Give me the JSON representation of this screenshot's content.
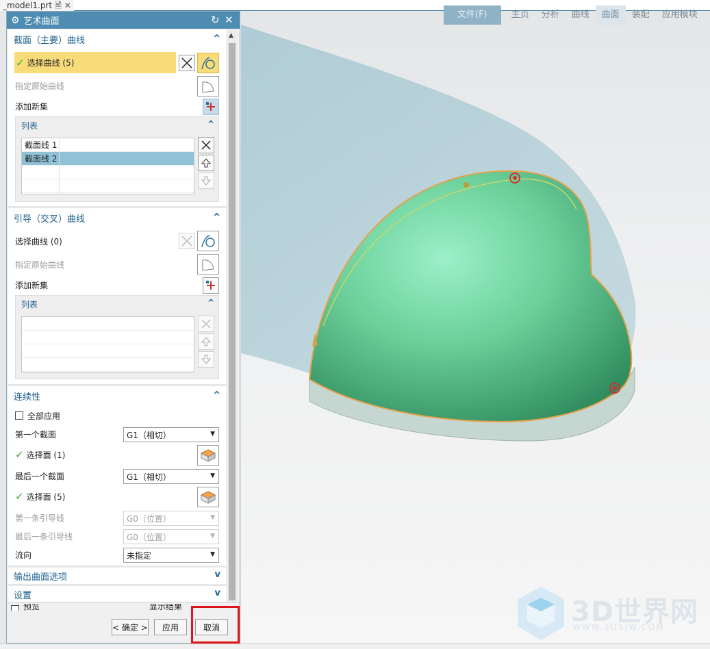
{
  "file_tab": {
    "name": "_model1.prt",
    "close_glyph": "✕",
    "doc_icon": "document-icon"
  },
  "ribbon": {
    "tabs": [
      {
        "label": "文件(F)",
        "state": "file"
      },
      {
        "label": "主页",
        "state": "normal"
      },
      {
        "label": "分析",
        "state": "normal"
      },
      {
        "label": "曲线",
        "state": "normal"
      },
      {
        "label": "曲面",
        "state": "active"
      },
      {
        "label": "装配",
        "state": "normal"
      },
      {
        "label": "应用模块",
        "state": "normal"
      }
    ]
  },
  "dialog": {
    "title": "艺术曲面",
    "section_primary": {
      "title": "截面（主要）曲线",
      "select_curve": "选择曲线 (5)",
      "specify_origin": "指定原始曲线",
      "add_new_set": "添加新集",
      "list_title": "列表",
      "list_items": [
        "截面线 1",
        "截面线 2",
        "",
        ""
      ],
      "selected_index": 1
    },
    "section_guide": {
      "title": "引导（交叉）曲线",
      "select_curve": "选择曲线 (0)",
      "specify_origin": "指定原始曲线",
      "add_new_set": "添加新集",
      "list_title": "列表"
    },
    "continuity": {
      "title": "连续性",
      "apply_all": "全部应用",
      "first_section": "第一个截面",
      "first_section_value": "G1（相切）",
      "select_face_1": "选择面 (1)",
      "last_section": "最后一个截面",
      "last_section_value": "G1（相切）",
      "select_face_2": "选择面 (5)",
      "first_guide": "第一条引导线",
      "first_guide_value": "G0（位置）",
      "last_guide": "最后一条引导线",
      "last_guide_value": "G0（位置）",
      "flow_direction": "流向",
      "flow_direction_value": "未指定"
    },
    "output_options": "输出曲面选项",
    "settings": "设置",
    "preview_partial": "预览",
    "show_result_partial": "显示结果",
    "buttons": {
      "ok": "< 确定 >",
      "apply": "应用",
      "cancel": "取消"
    }
  },
  "watermark": {
    "brand": "3D世界网",
    "url": "WWW.3DSJW.COM"
  },
  "colors": {
    "accent": "#4f8cb1",
    "selection": "#f8dc7a",
    "highlight_box": "#e0141b",
    "surface": "#5fc08a"
  }
}
